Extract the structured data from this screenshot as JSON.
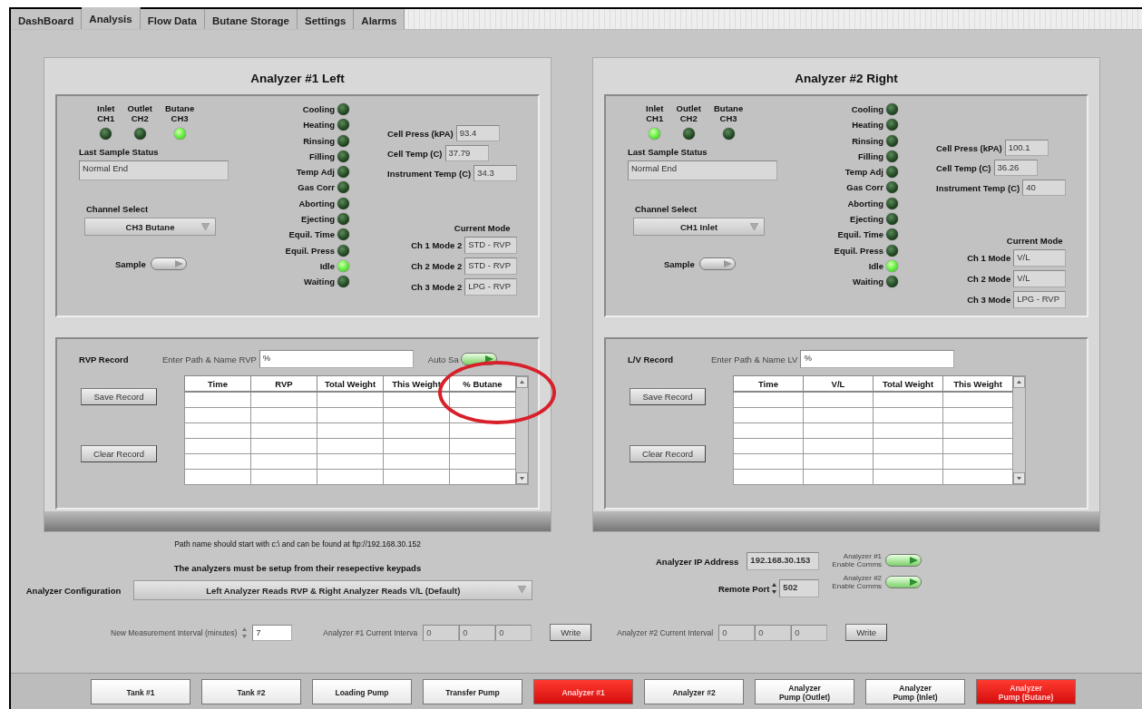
{
  "tabs": [
    {
      "label": "DashBoard",
      "selected": false
    },
    {
      "label": "Analysis",
      "selected": true
    },
    {
      "label": "Flow Data",
      "selected": false
    },
    {
      "label": "Butane Storage",
      "selected": false
    },
    {
      "label": "Settings",
      "selected": false
    },
    {
      "label": "Alarms",
      "selected": false
    }
  ],
  "analyzers": [
    {
      "title": "Analyzer #1 Left",
      "channels": [
        {
          "name": "Inlet",
          "ch": "CH1",
          "on": false
        },
        {
          "name": "Outlet",
          "ch": "CH2",
          "on": false
        },
        {
          "name": "Butane",
          "ch": "CH3",
          "on": true
        }
      ],
      "last_sample_status_label": "Last Sample Status",
      "last_sample_status": "Normal End",
      "channel_select_label": "Channel Select",
      "channel_select": "CH3 Butane",
      "sample_label": "Sample",
      "states": [
        {
          "label": "Cooling",
          "on": false
        },
        {
          "label": "Heating",
          "on": false
        },
        {
          "label": "Rinsing",
          "on": false
        },
        {
          "label": "Filling",
          "on": false
        },
        {
          "label": "Temp Adj",
          "on": false
        },
        {
          "label": "Gas Corr",
          "on": false
        },
        {
          "label": "Aborting",
          "on": false
        },
        {
          "label": "Ejecting",
          "on": false
        },
        {
          "label": "Equil. Time",
          "on": false
        },
        {
          "label": "Equil. Press",
          "on": false
        },
        {
          "label": "Idle",
          "on": true
        },
        {
          "label": "Waiting",
          "on": false
        }
      ],
      "readings": [
        {
          "label": "Cell Press (kPA)",
          "value": "93.4"
        },
        {
          "label": "Cell Temp (C)",
          "value": "37.79"
        },
        {
          "label": "Instrument Temp (C)",
          "value": "34.3"
        }
      ],
      "current_mode_title": "Current Mode",
      "modes": [
        {
          "label": "Ch 1 Mode 2",
          "value": "STD - RVP"
        },
        {
          "label": "Ch 2 Mode 2",
          "value": "STD - RVP"
        },
        {
          "label": "Ch 3 Mode 2",
          "value": "LPG - RVP"
        }
      ],
      "record": {
        "title": "RVP Record",
        "path_label": "Enter Path & Name RVP",
        "path_prefix": "%",
        "auto_save_label": "Auto Sa",
        "auto_save_on": true,
        "highlight_last_column": true,
        "save_button": "Save Record",
        "clear_button": "Clear Record",
        "columns": [
          "Time",
          "RVP",
          "Total Weight",
          "This Weight",
          "% Butane"
        ]
      }
    },
    {
      "title": "Analyzer #2 Right",
      "channels": [
        {
          "name": "Inlet",
          "ch": "CH1",
          "on": true
        },
        {
          "name": "Outlet",
          "ch": "CH2",
          "on": false
        },
        {
          "name": "Butane",
          "ch": "CH3",
          "on": false
        }
      ],
      "last_sample_status_label": "Last Sample Status",
      "last_sample_status": "Normal End",
      "channel_select_label": "Channel Select",
      "channel_select": "CH1 Inlet",
      "sample_label": "Sample",
      "states": [
        {
          "label": "Cooling",
          "on": false
        },
        {
          "label": "Heating",
          "on": false
        },
        {
          "label": "Rinsing",
          "on": false
        },
        {
          "label": "Filling",
          "on": false
        },
        {
          "label": "Temp Adj",
          "on": false
        },
        {
          "label": "Gas Corr",
          "on": false
        },
        {
          "label": "Aborting",
          "on": false
        },
        {
          "label": "Ejecting",
          "on": false
        },
        {
          "label": "Equil. Time",
          "on": false
        },
        {
          "label": "Equil. Press",
          "on": false
        },
        {
          "label": "Idle",
          "on": true
        },
        {
          "label": "Waiting",
          "on": false
        }
      ],
      "readings": [
        {
          "label": "Cell Press (kPA)",
          "value": "100.1"
        },
        {
          "label": "Cell Temp (C)",
          "value": "36.26"
        },
        {
          "label": "Instrument Temp (C)",
          "value": "40"
        }
      ],
      "current_mode_title": "Current Mode",
      "modes": [
        {
          "label": "Ch 1 Mode",
          "value": "V/L"
        },
        {
          "label": "Ch 2 Mode",
          "value": "V/L"
        },
        {
          "label": "Ch 3 Mode",
          "value": "LPG - RVP"
        }
      ],
      "record": {
        "title": "L/V Record",
        "path_label": "Enter Path & Name LV",
        "path_prefix": "%",
        "save_button": "Save Record",
        "clear_button": "Clear Record",
        "columns": [
          "Time",
          "V/L",
          "Total Weight",
          "This Weight"
        ]
      }
    }
  ],
  "path_note": "Path name should start with c:\\ and can be found at ftp://192.168.30.152",
  "setup_note": "The analyzers must be setup from their resepective keypads",
  "configuration": {
    "label": "Analyzer Configuration",
    "value": "Left Analyzer Reads RVP & Right Analyzer Reads V/L (Default)"
  },
  "ip_address": {
    "label": "Analyzer IP Address",
    "value": "192.168.30.153"
  },
  "remote_port": {
    "label": "Remote Port",
    "value": "502"
  },
  "enable_comms": [
    {
      "label": "Analyzer #1",
      "sub": "Enable Comms",
      "on": true
    },
    {
      "label": "Analyzer #2",
      "sub": "Enable Comms",
      "on": true
    }
  ],
  "measurement_interval": {
    "label": "New Measurement Interval (minutes)",
    "value": "7"
  },
  "current_intervals": [
    {
      "label": "Analyzer #1 Current Interva",
      "values": [
        "0",
        "0",
        "0"
      ],
      "button": "Write"
    },
    {
      "label": "Analyzer #2 Current Interval",
      "values": [
        "0",
        "0",
        "0"
      ],
      "button": "Write"
    }
  ],
  "nav": [
    {
      "lines": [
        "Tank #1"
      ],
      "alarm": false
    },
    {
      "lines": [
        "Tank #2"
      ],
      "alarm": false
    },
    {
      "lines": [
        "Loading Pump"
      ],
      "alarm": false
    },
    {
      "lines": [
        "Transfer Pump"
      ],
      "alarm": false
    },
    {
      "lines": [
        "Analyzer #1"
      ],
      "alarm": true
    },
    {
      "lines": [
        "Analyzer #2"
      ],
      "alarm": false
    },
    {
      "lines": [
        "Analyzer",
        "Pump (Outlet)"
      ],
      "alarm": false
    },
    {
      "lines": [
        "Analyzer",
        "Pump (Inlet)"
      ],
      "alarm": false
    },
    {
      "lines": [
        "Analyzer",
        "Pump (Butane)"
      ],
      "alarm": true
    }
  ]
}
